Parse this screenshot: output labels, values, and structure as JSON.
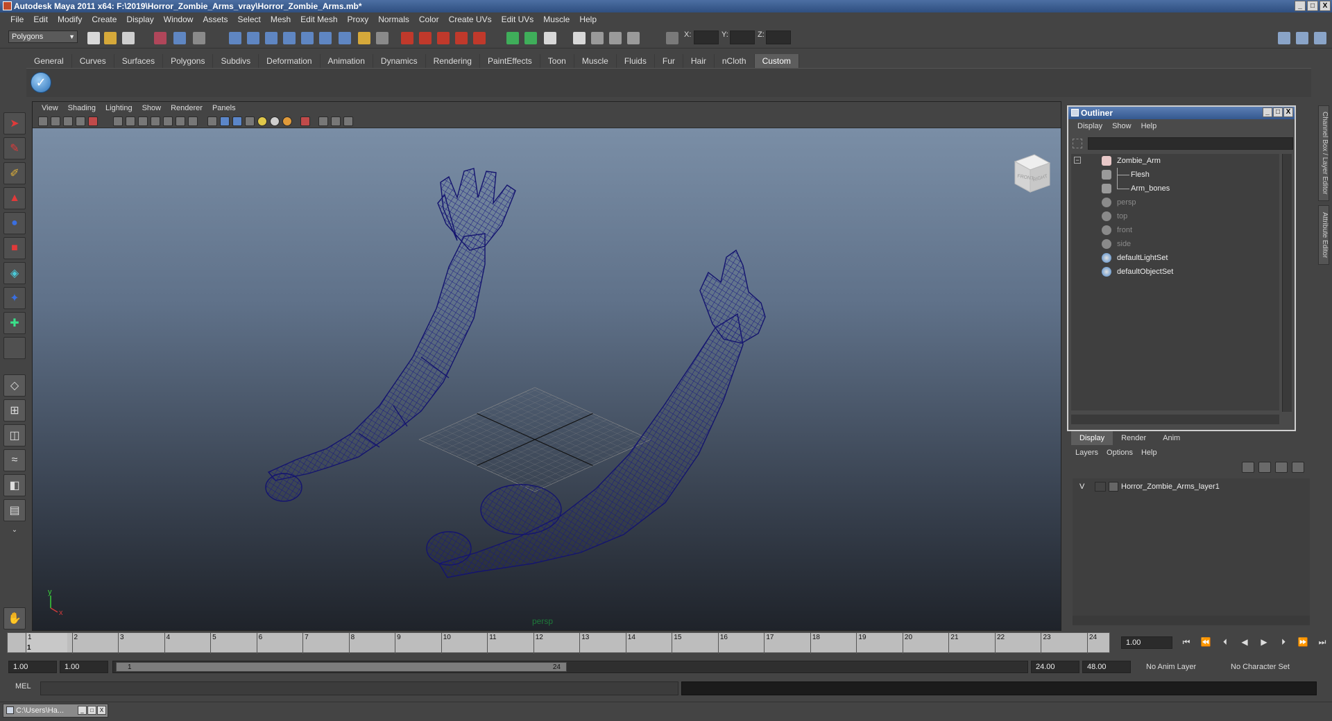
{
  "window": {
    "title": "Autodesk Maya 2011 x64: F:\\2019\\Horror_Zombie_Arms_vray\\Horror_Zombie_Arms.mb*",
    "controls": [
      "_",
      "□",
      "X"
    ]
  },
  "menubar": [
    "File",
    "Edit",
    "Modify",
    "Create",
    "Display",
    "Window",
    "Assets",
    "Select",
    "Mesh",
    "Edit Mesh",
    "Proxy",
    "Normals",
    "Color",
    "Create UVs",
    "Edit UVs",
    "Muscle",
    "Help"
  ],
  "statusline": {
    "mode": "Polygons",
    "x_label": "X:",
    "y_label": "Y:",
    "z_label": "Z:"
  },
  "shelf": {
    "tabs": [
      "General",
      "Curves",
      "Surfaces",
      "Polygons",
      "Subdivs",
      "Deformation",
      "Animation",
      "Dynamics",
      "Rendering",
      "PaintEffects",
      "Toon",
      "Muscle",
      "Fluids",
      "Fur",
      "Hair",
      "nCloth",
      "Custom"
    ],
    "active_tab": "Custom"
  },
  "viewport": {
    "menu": [
      "View",
      "Shading",
      "Lighting",
      "Show",
      "Renderer",
      "Panels"
    ],
    "camera": "persp",
    "viewcube_front": "FRONT",
    "viewcube_right": "RIGHT",
    "axis_y": "y",
    "axis_x": "x",
    "wire_color": "#1a1a80",
    "grid_color": "#8c8c8c"
  },
  "outliner": {
    "title": "Outliner",
    "menu": [
      "Display",
      "Show",
      "Help"
    ],
    "items": [
      {
        "label": "Zombie_Arm",
        "icon": "transform-icon",
        "dim": false
      },
      {
        "label": "Flesh",
        "icon": "mesh-icon",
        "dim": false
      },
      {
        "label": "Arm_bones",
        "icon": "mesh-icon",
        "dim": false
      },
      {
        "label": "persp",
        "icon": "camera-icon",
        "dim": true
      },
      {
        "label": "top",
        "icon": "camera-icon",
        "dim": true
      },
      {
        "label": "front",
        "icon": "camera-icon",
        "dim": true
      },
      {
        "label": "side",
        "icon": "camera-icon",
        "dim": true
      },
      {
        "label": "defaultLightSet",
        "icon": "set-icon",
        "dim": false
      },
      {
        "label": "defaultObjectSet",
        "icon": "set-icon",
        "dim": false
      }
    ]
  },
  "layer_editor": {
    "tabs": [
      "Display",
      "Render",
      "Anim"
    ],
    "active_tab": "Display",
    "menu": [
      "Layers",
      "Options",
      "Help"
    ],
    "layers": [
      {
        "visible": "V",
        "name": "Horror_Zombie_Arms_layer1"
      }
    ]
  },
  "side_tabs": [
    "Channel Box / Layer Editor",
    "Attribute Editor"
  ],
  "timeline": {
    "ticks": [
      "1",
      "2",
      "3",
      "4",
      "5",
      "6",
      "7",
      "8",
      "9",
      "10",
      "11",
      "12",
      "13",
      "14",
      "15",
      "16",
      "17",
      "18",
      "19",
      "20",
      "21",
      "22",
      "23",
      "24"
    ],
    "current_frame_marker": "1",
    "current_frame": "1.00"
  },
  "range": {
    "start": "1.00",
    "playback_start": "1.00",
    "bar_start": "1",
    "bar_end": "24",
    "playback_end": "24.00",
    "end": "48.00",
    "anim_layer": "No Anim Layer",
    "character_set": "No Character Set"
  },
  "command_line": {
    "label": "MEL"
  },
  "taskbar": {
    "item": "C:\\Users\\Ha..."
  }
}
